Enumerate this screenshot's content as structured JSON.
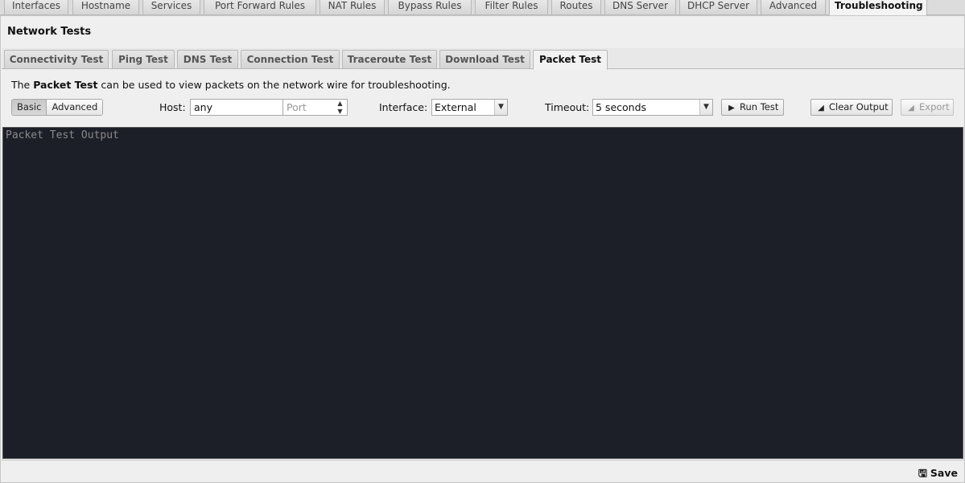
{
  "top_tabs": [
    {
      "label": "Interfaces"
    },
    {
      "label": "Hostname"
    },
    {
      "label": "Services"
    },
    {
      "label": "Port Forward Rules"
    },
    {
      "label": "NAT Rules"
    },
    {
      "label": "Bypass Rules"
    },
    {
      "label": "Filter Rules"
    },
    {
      "label": "Routes"
    },
    {
      "label": "DNS Server"
    },
    {
      "label": "DHCP Server"
    },
    {
      "label": "Advanced"
    },
    {
      "label": "Troubleshooting"
    }
  ],
  "active_top_tab": "Troubleshooting",
  "panel": {
    "title": "Network Tests"
  },
  "sub_tabs": [
    {
      "label": "Connectivity Test"
    },
    {
      "label": "Ping Test"
    },
    {
      "label": "DNS Test"
    },
    {
      "label": "Connection Test"
    },
    {
      "label": "Traceroute Test"
    },
    {
      "label": "Download Test"
    },
    {
      "label": "Packet Test"
    }
  ],
  "active_sub_tab": "Packet Test",
  "description": {
    "prefix": "The ",
    "bold": "Packet Test",
    "suffix": " can be used to view packets on the network wire for troubleshooting."
  },
  "mode": {
    "basic": "Basic",
    "advanced": "Advanced",
    "selected": "Basic"
  },
  "host": {
    "label": "Host:",
    "value": "any",
    "port_placeholder": "Port"
  },
  "interface": {
    "label": "Interface:",
    "value": "External"
  },
  "timeout": {
    "label": "Timeout:",
    "value": "5 seconds"
  },
  "buttons": {
    "run": "Run Test",
    "clear": "Clear Output",
    "export": "Export",
    "save": "Save"
  },
  "output": {
    "placeholder": "Packet Test Output"
  }
}
